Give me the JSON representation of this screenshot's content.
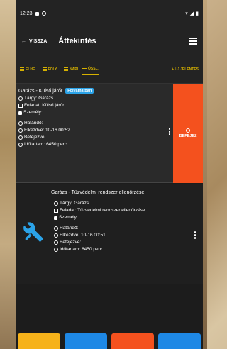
{
  "status": {
    "time": "12:23"
  },
  "app_bar": {
    "back_label": "VISSZA",
    "title": "Áttekintés"
  },
  "tabs": [
    {
      "label": "ELHÉ..."
    },
    {
      "label": "FOLY..."
    },
    {
      "label": "NAPI"
    },
    {
      "label": "ÖSS..."
    },
    {
      "label": "+ ÚJ JELENTÉS"
    }
  ],
  "cards": [
    {
      "title": "Garázs - Külső járőr",
      "badge": "Folyamatban",
      "subject": "Tárgy: Garázs",
      "task": "Feladat: Külső járőr",
      "person": "Személy:",
      "deadline": "Határidő:",
      "started": "Elkezdve: 10-16 00:52",
      "finished": "Befejezve:",
      "duration": "Időtartam: 6450 perc",
      "action_label": "BEFEJEZ"
    },
    {
      "title": "Garázs - Tűzvédelmi rendszer ellenőrzése",
      "subject": "Tárgy: Garázs",
      "task": "Feladat: Tűzvédelmi rendszer ellenőrzése",
      "person": "Személy:",
      "deadline": "Határidő:",
      "started": "Elkezdve: 10-16 00:51",
      "finished": "Befejezve:",
      "duration": "Időtartam: 6450 perc"
    }
  ],
  "colors": {
    "accent": "#d6b100",
    "badge": "#2ba3e8",
    "finish": "#f4511e",
    "bottom_bar": [
      "#f6b21a",
      "#1e88e5",
      "#f4511e",
      "#1e88e5"
    ]
  }
}
